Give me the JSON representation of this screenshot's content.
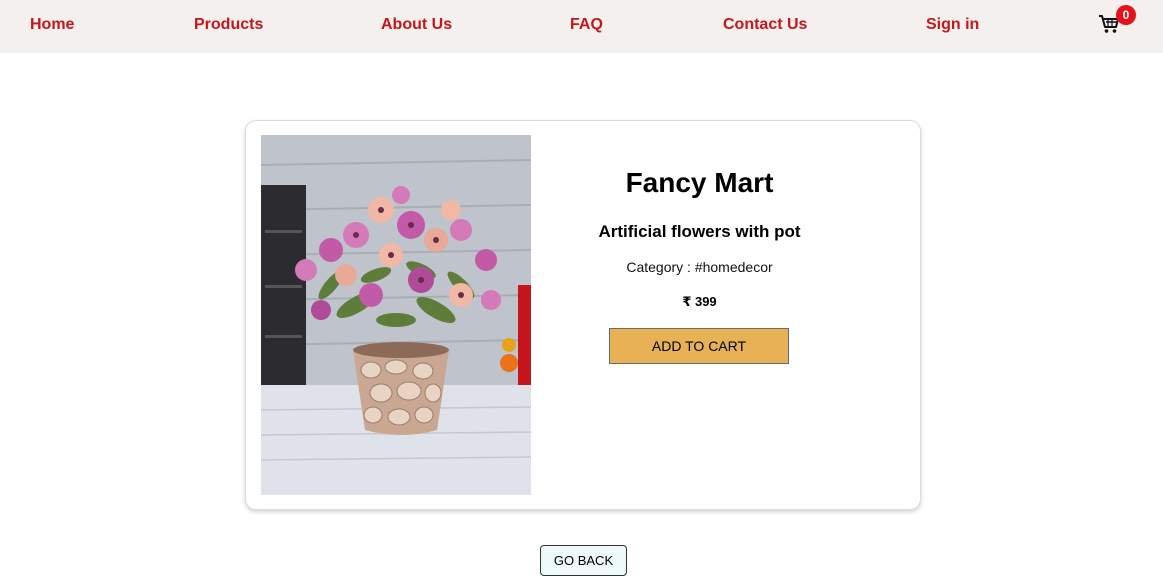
{
  "nav": {
    "links": [
      "Home",
      "Products",
      "About Us",
      "FAQ",
      "Contact Us",
      "Sign in"
    ],
    "cart_icon": "cart-icon",
    "cart_count": "0",
    "link_color": "#c4161c",
    "badge_color": "#e8101a",
    "background": "#f4f0ed"
  },
  "product": {
    "image_subject": "artificial-flowers-pot-image",
    "brand": "Fancy Mart",
    "title": "Artificial flowers with pot",
    "category": "Category : #homedecor",
    "price": "₹ 399",
    "add_to_cart_label": "ADD TO CART",
    "button_color": "#e6b255"
  },
  "actions": {
    "go_back_label": "GO BACK"
  }
}
